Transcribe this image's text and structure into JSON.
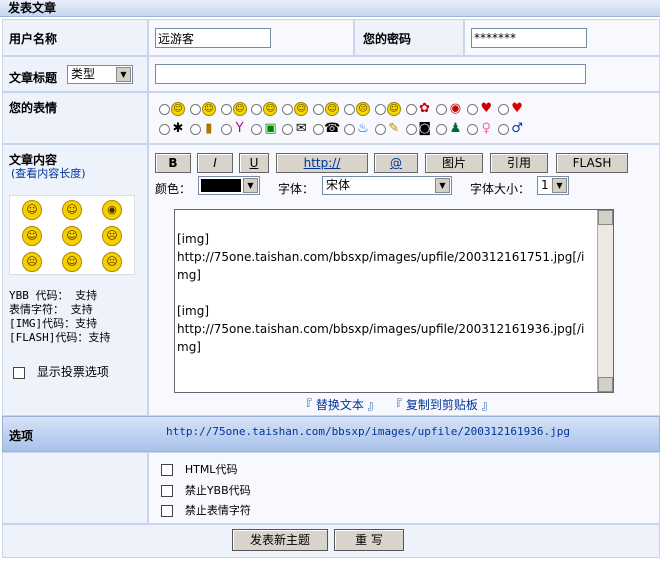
{
  "header": {
    "title": "发表文章"
  },
  "form": {
    "username_label": "用户名称",
    "username_value": "远游客",
    "password_label": "您的密码",
    "password_value": "*******",
    "subject_label": "文章标题",
    "type_select": "类型",
    "subject_value": "",
    "emotion_label": "您的表情",
    "content_label": "文章内容",
    "check_length_link": "(查看内容长度)",
    "ybb_support": "YBB 代码： 支持",
    "emote_support": "表情字符： 支持",
    "img_support": "[IMG]代码：支持",
    "flash_support": "[FLASH]代码：支持",
    "show_vote_label": "显示投票选项"
  },
  "toolbar": {
    "bold": "B",
    "italic": "I",
    "underline": "U",
    "link": "http://",
    "email": "@",
    "image": "图片",
    "quote": "引用",
    "flash": "FLASH",
    "color_label": "颜色：",
    "font_label": "字体：",
    "font_value": "宋体",
    "size_label": "字体大小：",
    "size_value": "1"
  },
  "editor": {
    "content": "[img]\nhttp://75one.taishan.com/bbsxp/images/upfile/200312161751.jpg[/img]\n\n[img]\nhttp://75one.taishan.com/bbsxp/images/upfile/200312161936.jpg[/img]",
    "replace_text": "『 替换文本 』",
    "copy_clipboard": "『 复制到剪贴板 』"
  },
  "options": {
    "label": "选项",
    "url": "http://75one.taishan.com/bbsxp/images/upfile/200312161936.jpg",
    "html_code": "HTML代码",
    "disable_ybb": "禁止YBB代码",
    "disable_emote": "禁止表情字符"
  },
  "actions": {
    "submit": "发表新主题",
    "reset": "重 写"
  },
  "colors": {
    "header_bg": "#c7d6f0",
    "link": "#003399",
    "text_color_swatch": "#000000"
  }
}
